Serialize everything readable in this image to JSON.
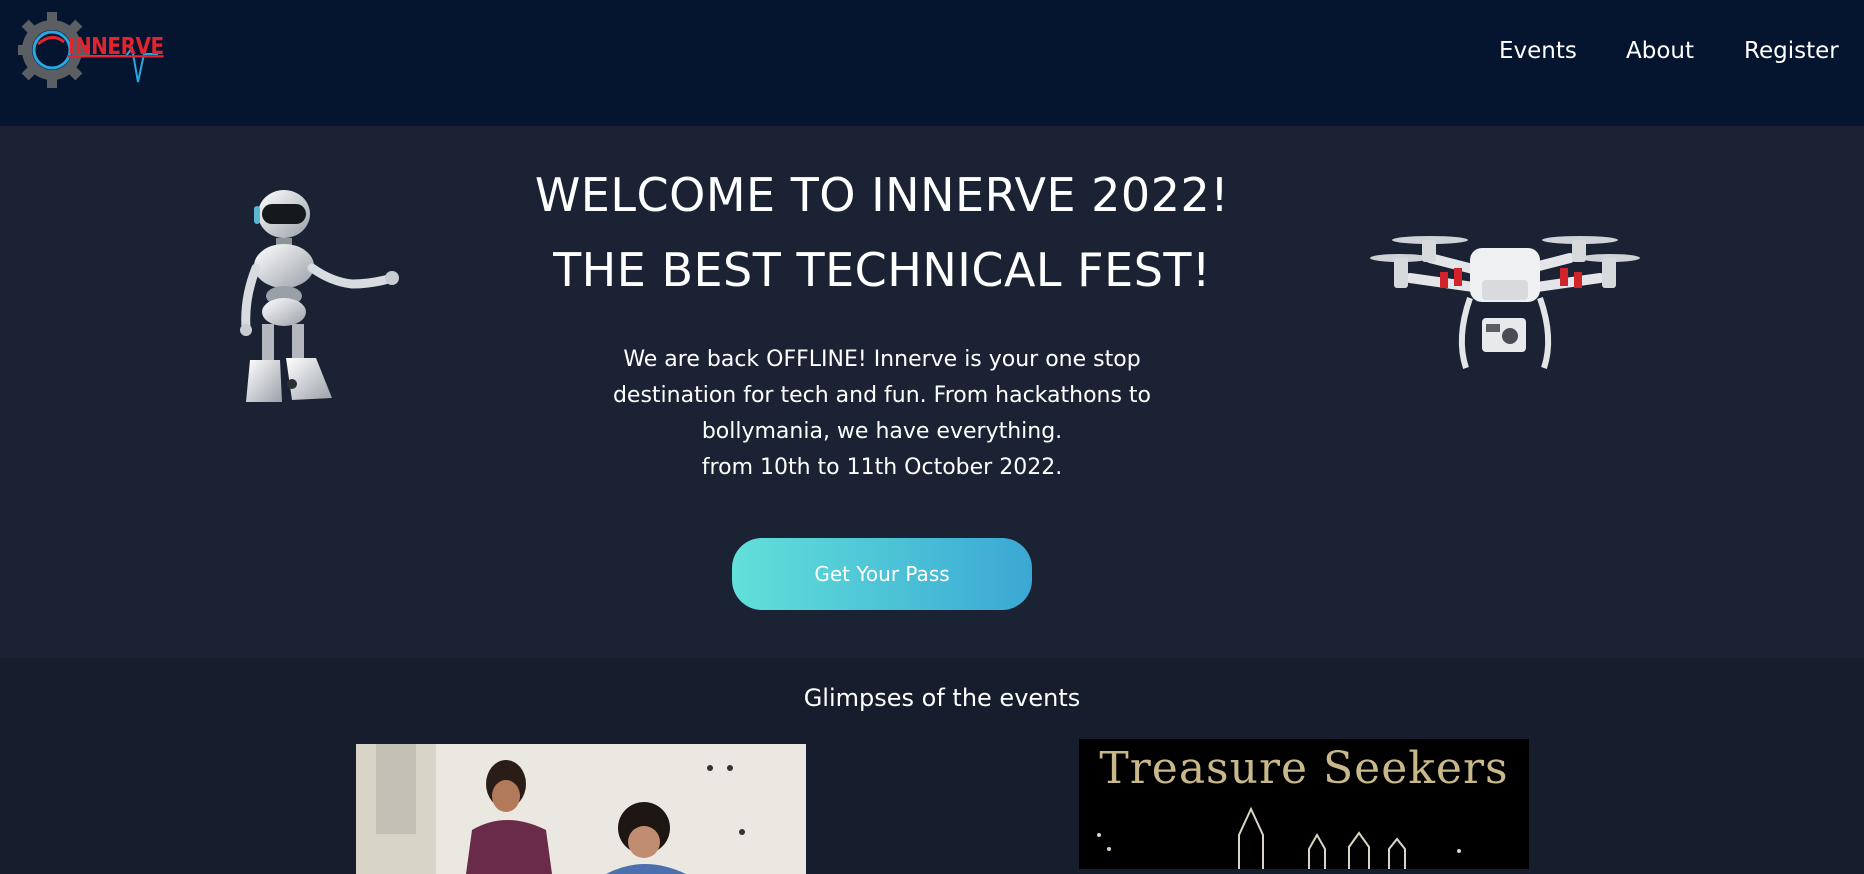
{
  "header": {
    "logo_text": "INNERVE",
    "nav": [
      {
        "label": "Events"
      },
      {
        "label": "About"
      },
      {
        "label": "Register"
      }
    ]
  },
  "hero": {
    "title_line1": "WELCOME TO INNERVE 2022!",
    "title_line2": "THE BEST TECHNICAL FEST!",
    "description": "We are back OFFLINE! Innerve is your one stop destination for tech and fun. From hackathons to bollymania, we have everything.",
    "dates": "from 10th to 11th October 2022.",
    "cta_label": "Get Your Pass"
  },
  "glimpses": {
    "title": "Glimpses of the events",
    "right_image_text": "Treasure Seekers"
  },
  "colors": {
    "header_bg": "#05152f",
    "hero_bg": "#1b2233",
    "section_bg": "#161d2c",
    "cta_gradient_start": "#62e0da",
    "cta_gradient_end": "#3aa8d4",
    "logo_red": "#e2242f",
    "logo_blue": "#2aa7e0"
  }
}
